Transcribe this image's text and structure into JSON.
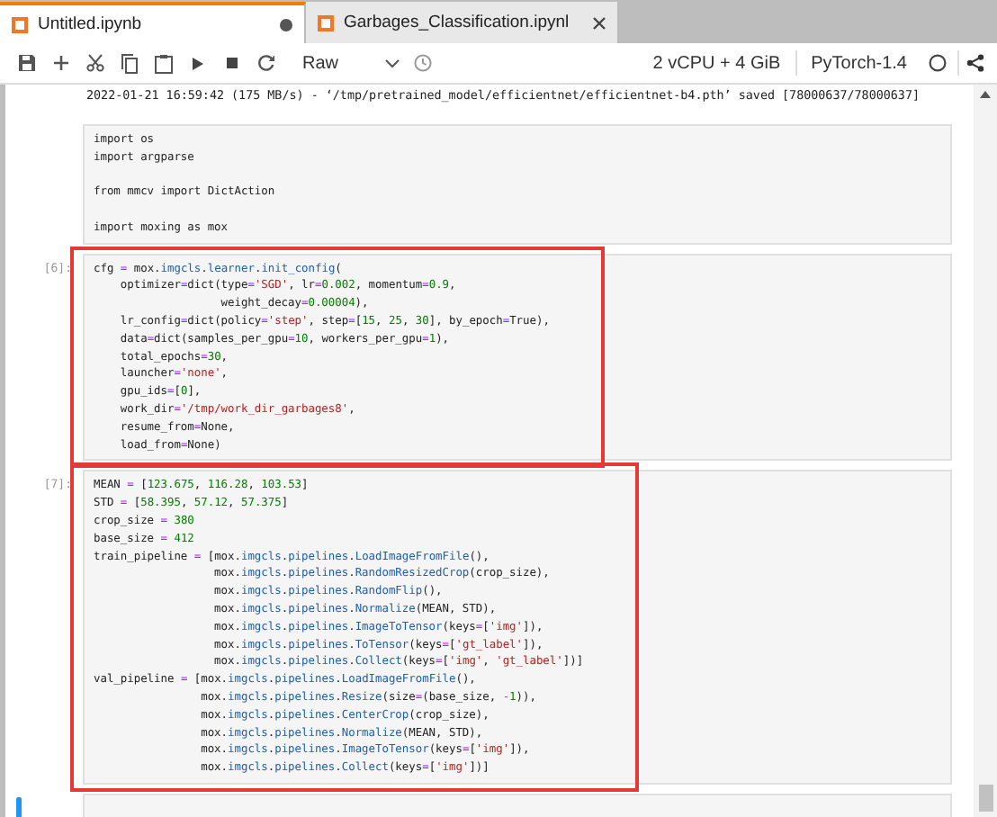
{
  "tabs": [
    {
      "label": "Untitled.ipynb",
      "selected": true,
      "modified": true
    },
    {
      "label": "Garbages_Classification.ipynl",
      "selected": false,
      "modified": false
    }
  ],
  "toolbar": {
    "cell_type": "Raw",
    "resources": "2 vCPU + 4 GiB",
    "kernel": "PyTorch-1.4"
  },
  "cells": [
    {
      "kind": "output",
      "source": "2022-01-21 16:59:42 (175 MB/s) - ‘/tmp/pretrained_model/efficientnet/efficientnet-b4.pth’ saved [78000637/78000637]",
      "highlighted": false,
      "active": false
    },
    {
      "kind": "raw",
      "source": "import os\nimport argparse\n\nfrom mmcv import DictAction\n\nimport moxing as mox",
      "highlighted": false,
      "active": false
    },
    {
      "kind": "code",
      "prompt": "[6]:",
      "source": "cfg = mox.imgcls.learner.init_config(\n    optimizer=dict(type='SGD', lr=0.002, momentum=0.9,\n                   weight_decay=0.00004),\n    lr_config=dict(policy='step', step=[15, 25, 30], by_epoch=True),\n    data=dict(samples_per_gpu=10, workers_per_gpu=1),\n    total_epochs=30,\n    launcher='none',\n    gpu_ids=[0],\n    work_dir='/tmp/work_dir_garbages8',\n    resume_from=None,\n    load_from=None)",
      "highlighted": true,
      "active": false
    },
    {
      "kind": "code",
      "prompt": "[7]:",
      "source": "MEAN = [123.675, 116.28, 103.53]\nSTD = [58.395, 57.12, 57.375]\ncrop_size = 380\nbase_size = 412\ntrain_pipeline = [mox.imgcls.pipelines.LoadImageFromFile(),\n                  mox.imgcls.pipelines.RandomResizedCrop(crop_size),\n                  mox.imgcls.pipelines.RandomFlip(),\n                  mox.imgcls.pipelines.Normalize(MEAN, STD),\n                  mox.imgcls.pipelines.ImageToTensor(keys=['img']),\n                  mox.imgcls.pipelines.ToTensor(keys=['gt_label']),\n                  mox.imgcls.pipelines.Collect(keys=['img', 'gt_label'])]\nval_pipeline = [mox.imgcls.pipelines.LoadImageFromFile(),\n                mox.imgcls.pipelines.Resize(size=(base_size, -1)),\n                mox.imgcls.pipelines.CenterCrop(crop_size),\n                mox.imgcls.pipelines.Normalize(MEAN, STD),\n                mox.imgcls.pipelines.ImageToTensor(keys=['img']),\n                mox.imgcls.pipelines.Collect(keys=['img'])]",
      "highlighted": true,
      "active": false
    },
    {
      "kind": "code",
      "highlighted": false,
      "active": true
    }
  ]
}
